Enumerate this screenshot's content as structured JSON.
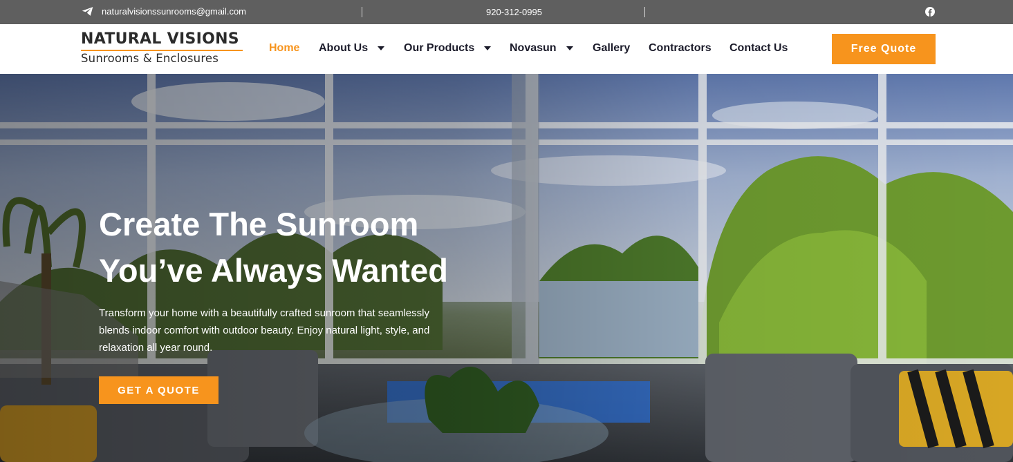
{
  "topbar": {
    "email": "naturalvisionssunrooms@gmail.com",
    "phone": "920-312-0995",
    "icons": [
      "telegram-send-icon",
      "facebook-icon"
    ]
  },
  "logo": {
    "line1": "NATURAL VISIONS",
    "line2": "Sunrooms & Enclosures"
  },
  "nav": {
    "items": [
      {
        "label": "Home",
        "active": true
      },
      {
        "label": "About Us",
        "dropdown": true
      },
      {
        "label": "Our Products",
        "dropdown": true
      },
      {
        "label": "Novasun",
        "dropdown": true
      },
      {
        "label": "Gallery"
      },
      {
        "label": "Contractors"
      },
      {
        "label": "Contact Us"
      }
    ],
    "cta": "Free Quote"
  },
  "hero": {
    "title_line1": "Create The Sunroom",
    "title_line2": "You’ve Always Wanted",
    "text": "Transform your home with a beautifully crafted sunroom that seamlessly blends indoor comfort with outdoor beauty. Enjoy natural light, style, and relaxation all year round.",
    "button": "GET A QUOTE"
  },
  "colors": {
    "accent": "#f7941d",
    "topbar": "#5f5f5f",
    "nav_text": "#1b1b2a"
  }
}
